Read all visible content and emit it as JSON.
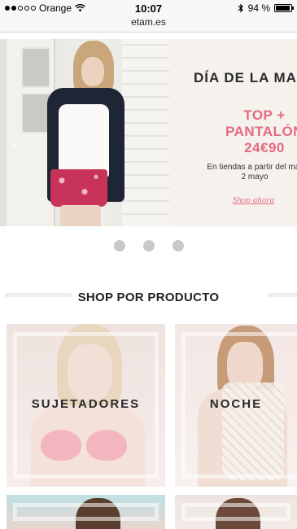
{
  "status_bar": {
    "carrier": "Orange",
    "time": "10:07",
    "battery_percent": "94 %",
    "battery_level": 0.94,
    "signal_dots_filled": 2,
    "icons": [
      "signal-dots-icon",
      "wifi-icon",
      "bluetooth-icon",
      "battery-icon"
    ]
  },
  "browser": {
    "url": "etam.es"
  },
  "hero": {
    "title": "DÍA DE LA MAD",
    "offer_line1": "TOP +",
    "offer_line2": "PANTALÓN",
    "offer_price": "24€90",
    "subtitle_line1": "En tiendas a partir del mar",
    "subtitle_line2": "2 mayo",
    "cta": "Shop ahora",
    "prev_arrow": "‹",
    "accent_color": "#e46a7f"
  },
  "carousel": {
    "slides": 3
  },
  "section": {
    "title": "SHOP POR PRODUCTO"
  },
  "products": [
    {
      "label": "SUJETADORES"
    },
    {
      "label": "NOCHE"
    },
    {
      "label": ""
    },
    {
      "label": ""
    }
  ]
}
